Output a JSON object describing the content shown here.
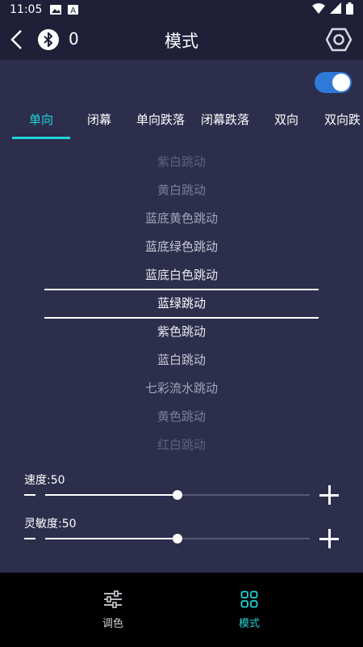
{
  "status_bar": {
    "time": "11:05"
  },
  "header": {
    "title": "模式",
    "bt_count": "0"
  },
  "tabs": [
    {
      "label": "单向",
      "active": true
    },
    {
      "label": "闭幕",
      "active": false
    },
    {
      "label": "单向跌落",
      "active": false
    },
    {
      "label": "闭幕跌落",
      "active": false
    },
    {
      "label": "双向",
      "active": false
    },
    {
      "label": "双向跌",
      "active": false
    }
  ],
  "picker": {
    "items": [
      "紫白跳动",
      "黄白跳动",
      "蓝底黄色跳动",
      "蓝底绿色跳动",
      "蓝底白色跳动",
      "蓝绿跳动",
      "紫色跳动",
      "蓝白跳动",
      "七彩流水跳动",
      "黄色跳动",
      "红白跳动"
    ],
    "selected_index": 5
  },
  "sliders": [
    {
      "label": "速度:50",
      "value": 50
    },
    {
      "label": "灵敏度:50",
      "value": 50
    }
  ],
  "bottom_nav": [
    {
      "label": "调色",
      "active": false
    },
    {
      "label": "模式",
      "active": true
    }
  ],
  "colors": {
    "accent": "#21d4d8",
    "toggle": "#2f79d9",
    "background": "#2c2e4c",
    "header": "#1f2038"
  }
}
